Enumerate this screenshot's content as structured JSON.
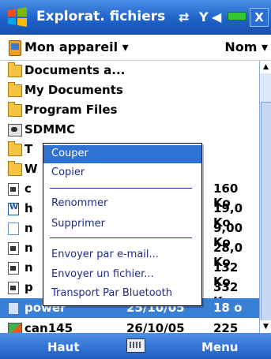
{
  "titlebar": {
    "title": "Explorat. fichiers",
    "icons": [
      "connectivity-icon",
      "signal-icon",
      "volume-icon",
      "battery-icon"
    ],
    "close": "X"
  },
  "location": {
    "label": "Mon appareil",
    "sort": "Nom"
  },
  "files": [
    {
      "name": "Documents a...",
      "icon": "folder-icon"
    },
    {
      "name": "My Documents",
      "icon": "folder-icon"
    },
    {
      "name": "Program Files",
      "icon": "folder-icon"
    },
    {
      "name": "SDMMC",
      "icon": "sdcard-icon"
    },
    {
      "name": "T",
      "icon": "folder-icon"
    },
    {
      "name": "W",
      "icon": "folder-icon"
    },
    {
      "name": "c",
      "icon": "file-icon",
      "size": "160 Ko"
    },
    {
      "name": "h",
      "icon": "word-doc-icon",
      "size": "19,0 Ko"
    },
    {
      "name": "n",
      "icon": "text-file-icon",
      "size": "9,00 Ko"
    },
    {
      "name": "n",
      "icon": "file-icon",
      "size": "28,0 Ko"
    },
    {
      "name": "n",
      "icon": "file-icon",
      "size": "132 Ko"
    },
    {
      "name": "p",
      "icon": "file-icon",
      "size": "332 Ko"
    },
    {
      "name": "power",
      "icon": "swap-file-icon",
      "date": "25/10/05",
      "size": "18 o",
      "selected": true
    },
    {
      "name": "can145",
      "icon": "image-file-icon",
      "date": "26/10/05",
      "size": "225 Ko"
    }
  ],
  "menu": {
    "items": [
      "Couper",
      "Copier",
      "Renommer",
      "Supprimer",
      "Envoyer par e-mail...",
      "Envoyer un fichier...",
      "Transport Par Bluetooth"
    ]
  },
  "bottom": {
    "left": "Haut",
    "right": "Menu",
    "keyboard": "keyboard-icon"
  }
}
